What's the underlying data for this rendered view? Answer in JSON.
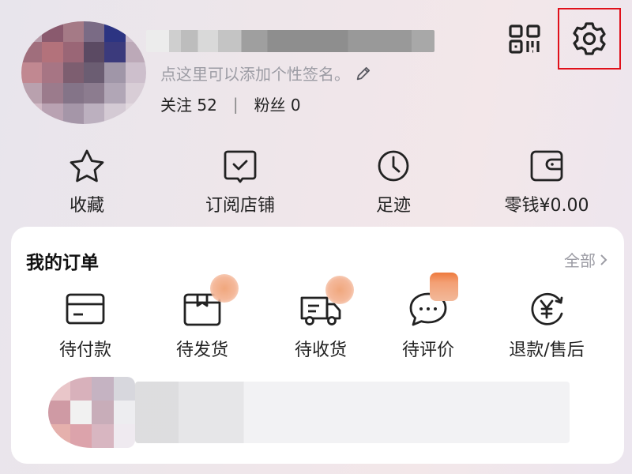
{
  "profile": {
    "signature_text": "点这里可以添加个性签名。",
    "follow_label": "关注",
    "follow_count": "52",
    "separator": "|",
    "fans_label": "粉丝",
    "fans_count": "0"
  },
  "header_icons": {
    "qr": "qr-code-icon",
    "settings": "gear-icon",
    "settings_highlight_color": "#e0101a"
  },
  "quick_actions": [
    {
      "label": "收藏",
      "icon": "star-icon"
    },
    {
      "label": "订阅店铺",
      "icon": "subscribe-check-icon"
    },
    {
      "label": "足迹",
      "icon": "clock-icon"
    },
    {
      "label": "零钱¥0.00",
      "icon": "wallet-icon"
    }
  ],
  "orders": {
    "title": "我的订单",
    "all_label": "全部",
    "items": [
      {
        "label": "待付款",
        "icon": "card-icon"
      },
      {
        "label": "待发货",
        "icon": "package-icon"
      },
      {
        "label": "待收货",
        "icon": "truck-icon"
      },
      {
        "label": "待评价",
        "icon": "chat-icon"
      },
      {
        "label": "退款/售后",
        "icon": "refund-yuan-icon"
      }
    ]
  }
}
